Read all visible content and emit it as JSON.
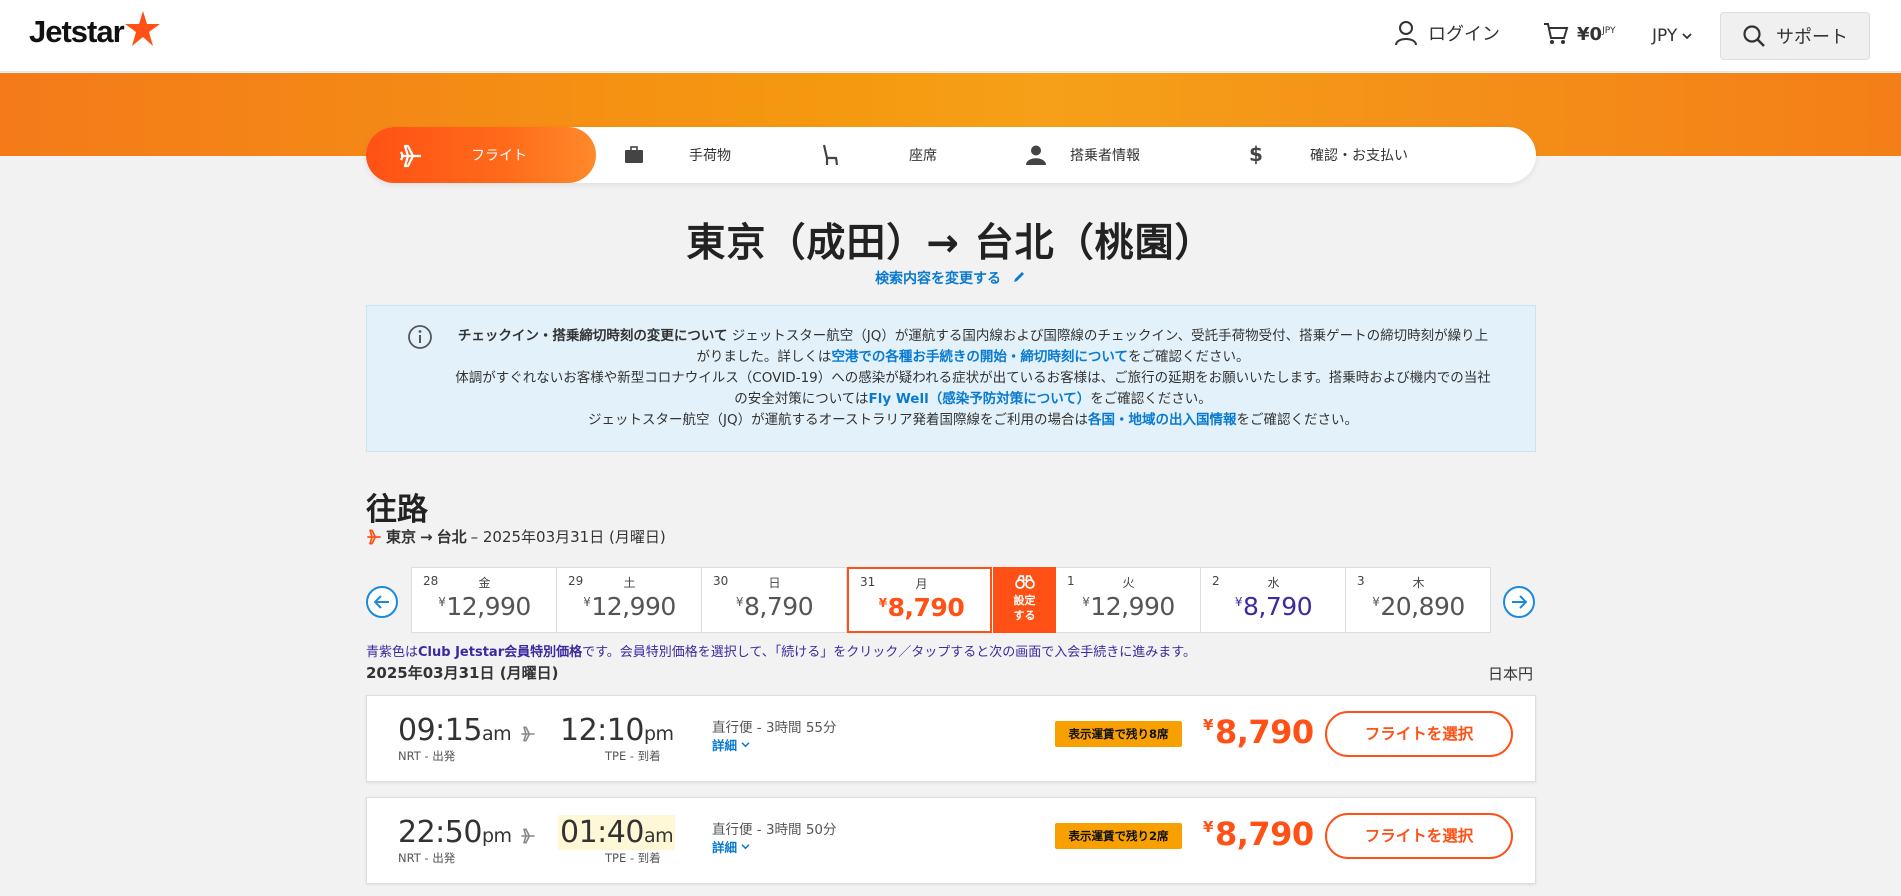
{
  "header": {
    "logo_text": "Jetstar",
    "login_label": "ログイン",
    "cart_amount": "¥0",
    "cart_currency": "JPY",
    "currency": "JPY",
    "support_label": "サポート"
  },
  "steps": [
    {
      "label": "フライト",
      "icon": "airplane-icon",
      "active": true
    },
    {
      "label": "手荷物",
      "icon": "luggage-icon",
      "active": false
    },
    {
      "label": "座席",
      "icon": "seat-icon",
      "active": false
    },
    {
      "label": "搭乗者情報",
      "icon": "person-icon",
      "active": false
    },
    {
      "label": "確認・お支払い",
      "icon": "dollar-icon",
      "active": false
    }
  ],
  "route": {
    "title": "東京（成田）→ 台北（桃園）",
    "change_search": "検索内容を変更する"
  },
  "info": {
    "p1_bold": "チェックイン・搭乗締切時刻の変更について",
    "p1_text": " ジェットスター航空（JQ）が運航する国内線および国際線のチェックイン、受託手荷物受付、搭乗ゲートの締切時刻が繰り上がりました。詳しくは",
    "p1_link": "空港での各種お手続きの開始・締切時刻について",
    "p1_end": "をご確認ください。",
    "p2_text": "体調がすぐれないお客様や新型コロナウイルス（COVID-19）への感染が疑われる症状が出ているお客様は、ご旅行の延期をお願いいたします。搭乗時および機内での当社の安全対策については",
    "p2_link": "Fly Well（感染予防対策について）",
    "p2_end": "をご確認ください。",
    "p3_text": "ジェットスター航空（JQ）が運航するオーストラリア発着国際線をご利用の場合は",
    "p3_link": "各国・地域の出入国情報",
    "p3_end": "をご確認ください。"
  },
  "outbound": {
    "title": "往路",
    "from": "東京",
    "arrow": "→",
    "to": "台北",
    "date_text": "– 2025年03月31日 (月曜日)"
  },
  "dates": [
    {
      "num": "28",
      "day": "金",
      "price": "12,990",
      "state": "normal"
    },
    {
      "num": "29",
      "day": "土",
      "price": "12,990",
      "state": "normal"
    },
    {
      "num": "30",
      "day": "日",
      "price": "8,790",
      "state": "normal"
    },
    {
      "num": "31",
      "day": "月",
      "price": "8,790",
      "state": "selected"
    },
    {
      "num": "1",
      "day": "火",
      "price": "12,990",
      "state": "normal"
    },
    {
      "num": "2",
      "day": "水",
      "price": "8,790",
      "state": "member"
    },
    {
      "num": "3",
      "day": "木",
      "price": "20,890",
      "state": "normal"
    }
  ],
  "price_watch_label_1": "設定",
  "price_watch_label_2": "する",
  "yen": "¥",
  "member_note": {
    "pre": "青紫色は",
    "bold": "Club Jetstar会員特別価格",
    "post": "です。会員特別価格を選択して、「続ける」をクリック／タップすると次の画面で入会手続きに進みます。"
  },
  "selected_date_line": "2025年03月31日 (月曜日)",
  "currency_note": "日本円",
  "flights": [
    {
      "dep_time": "09:15",
      "dep_ampm": "am",
      "dep_label": "NRT - 出発",
      "arr_time": "12:10",
      "arr_ampm": "pm",
      "arr_label": "TPE - 到着",
      "duration": "直行便 - 3時間 55分",
      "detail": "詳細",
      "badge": "表示運賃で残り8席",
      "price": "8,790",
      "button": "フライトを選択"
    },
    {
      "dep_time": "22:50",
      "dep_ampm": "pm",
      "dep_label": "NRT - 出発",
      "arr_time": "01:40",
      "arr_ampm": "am",
      "arr_label": "TPE - 到着",
      "duration": "直行便 - 3時間 50分",
      "detail": "詳細",
      "badge": "表示運賃で残り2席",
      "price": "8,790",
      "button": "フライトを選択"
    }
  ],
  "colors": {
    "brand_orange": "#ff5115",
    "band_orange": "#f59a10",
    "link_blue": "#0a7ad1",
    "member_purple": "#3b2aa0",
    "badge_amber": "#f7a000"
  }
}
